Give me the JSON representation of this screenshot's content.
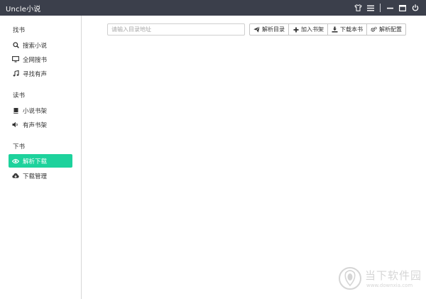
{
  "app": {
    "title": "Uncle小说"
  },
  "titlebar": {
    "icons": [
      "shirt-icon",
      "menu-icon",
      "minimize-icon",
      "maximize-icon",
      "power-icon"
    ]
  },
  "sidebar": {
    "groups": [
      {
        "title": "找书",
        "items": [
          {
            "label": "搜索小说",
            "icon": "search-icon"
          },
          {
            "label": "全网搜书",
            "icon": "monitor-icon"
          },
          {
            "label": "寻找有声",
            "icon": "music-icon"
          }
        ]
      },
      {
        "title": "读书",
        "items": [
          {
            "label": "小说书架",
            "icon": "book-icon"
          },
          {
            "label": "有声书架",
            "icon": "volume-icon"
          }
        ]
      },
      {
        "title": "下书",
        "items": [
          {
            "label": "解析下载",
            "icon": "eye-icon",
            "active": true
          },
          {
            "label": "下载管理",
            "icon": "cloud-download-icon"
          }
        ]
      }
    ]
  },
  "toolbar": {
    "url_placeholder": "请输入目录地址",
    "url_value": "",
    "buttons": [
      {
        "label": "解析目录",
        "icon": "send-icon"
      },
      {
        "label": "加入书架",
        "icon": "plus-icon"
      },
      {
        "label": "下载本书",
        "icon": "download-icon"
      },
      {
        "label": "解析配置",
        "icon": "cogs-icon"
      }
    ]
  },
  "watermark": {
    "name": "当下软件园",
    "url": "www.downxia.com"
  },
  "colors": {
    "titlebar": "#3b3f4b",
    "accent": "#1dd29c"
  }
}
